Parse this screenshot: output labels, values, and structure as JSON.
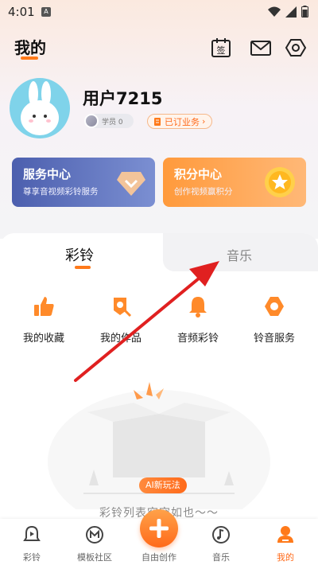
{
  "status_bar": {
    "time": "4:01",
    "app_icon_letter": "A"
  },
  "header": {
    "title": "我的",
    "icons": [
      "calendar-sign-icon",
      "mail-icon",
      "settings-icon"
    ],
    "calendar_glyph": "签"
  },
  "profile": {
    "username": "用户7215",
    "member_label": "学员 0",
    "subscribed_label": "已订业务"
  },
  "cards": {
    "service": {
      "title": "服务中心",
      "subtitle": "尊享音视频彩铃服务"
    },
    "points": {
      "title": "积分中心",
      "subtitle": "创作视频赢积分"
    }
  },
  "tabs": {
    "active": "彩铃",
    "inactive": "音乐"
  },
  "quick_actions": [
    {
      "label": "我的收藏",
      "icon": "thumbs-up-icon"
    },
    {
      "label": "我的作品",
      "icon": "works-icon"
    },
    {
      "label": "音频彩铃",
      "icon": "bell-icon"
    },
    {
      "label": "铃音服务",
      "icon": "gear-icon"
    }
  ],
  "empty_state": {
    "ai_chip": "AI新玩法",
    "text": "彩铃列表空空如也～～"
  },
  "bottom_nav": {
    "items": [
      {
        "label": "彩铃",
        "icon": "ringtone-icon"
      },
      {
        "label": "模板社区",
        "icon": "template-icon"
      },
      {
        "label": "自由创作",
        "icon": "plus-icon"
      },
      {
        "label": "音乐",
        "icon": "music-note-icon"
      },
      {
        "label": "我的",
        "icon": "profile-icon"
      }
    ],
    "active_index": 4
  },
  "colors": {
    "accent": "#ff6a1a",
    "service_card": "#5a6bb8",
    "points_card": "#ffa04a",
    "annotation_arrow": "#e02020"
  }
}
